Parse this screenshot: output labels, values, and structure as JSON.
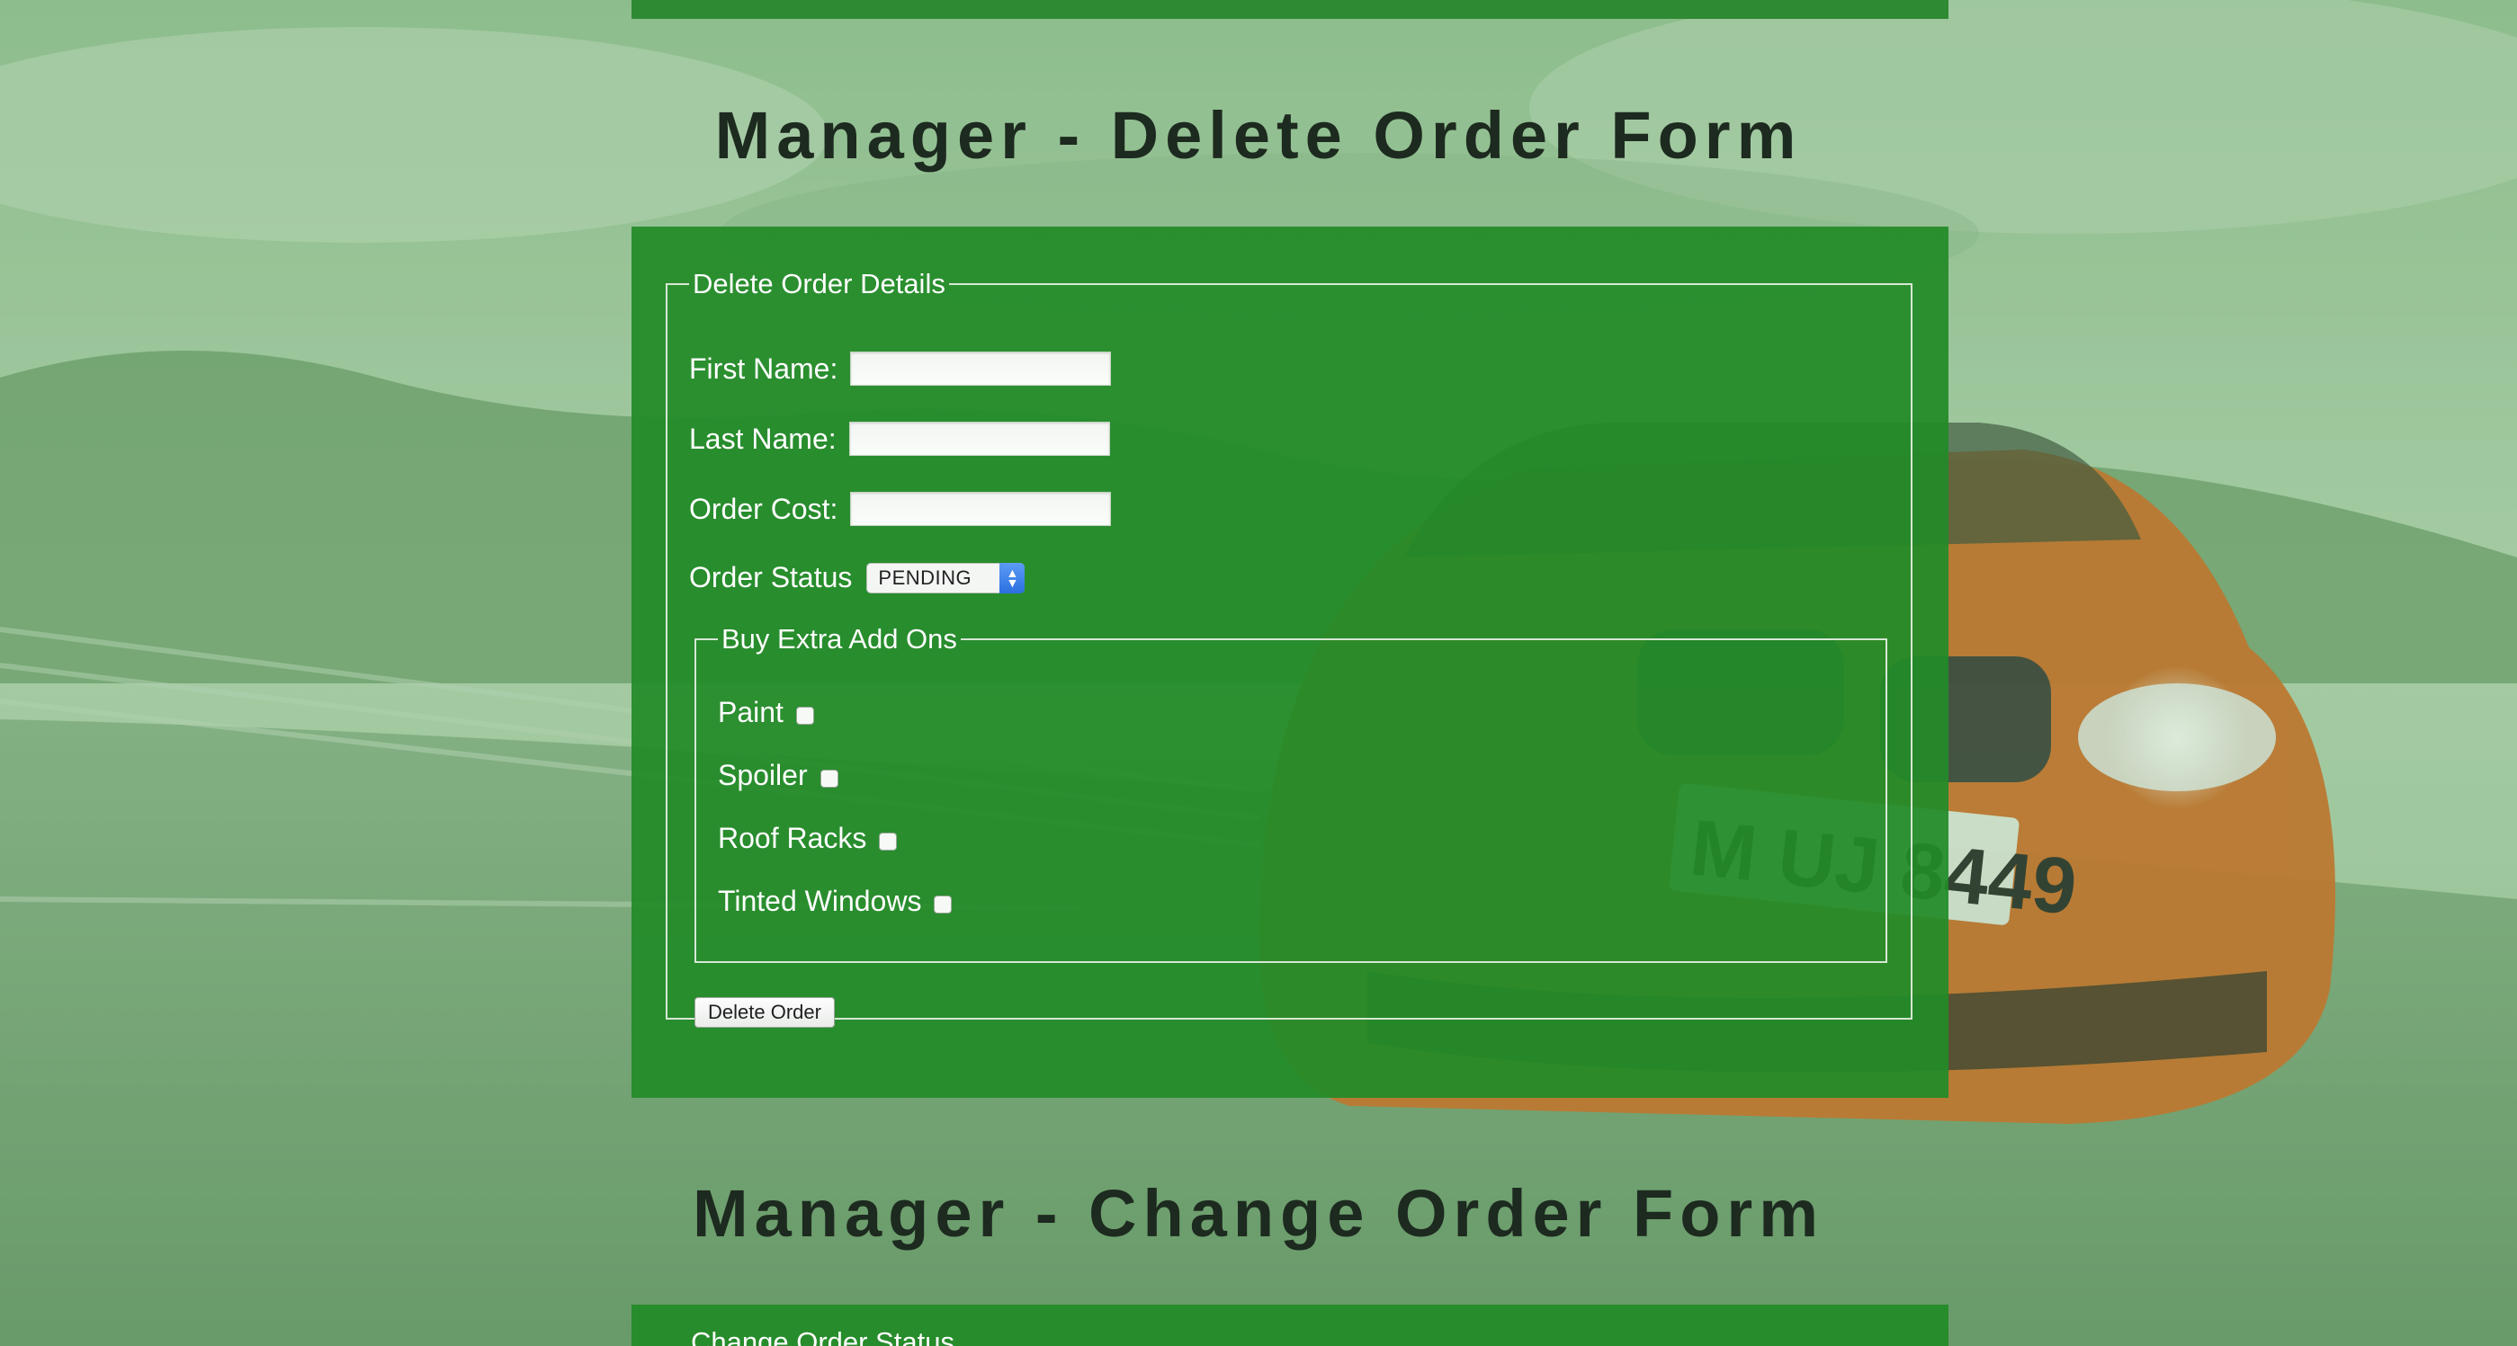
{
  "colors": {
    "panel_green": "#228b28",
    "title_text": "#1d2a1f",
    "background_tint": "#a9c9a8",
    "car_orange": "#d4722c"
  },
  "delete_form": {
    "page_title": "Manager - Delete Order Form",
    "legend": "Delete Order Details",
    "first_name_label": "First Name:",
    "first_name_value": "",
    "last_name_label": "Last Name:",
    "last_name_value": "",
    "order_cost_label": "Order Cost:",
    "order_cost_value": "",
    "order_status_label": "Order Status",
    "order_status_selected": "PENDING",
    "addons": {
      "legend": "Buy Extra Add Ons",
      "items": [
        {
          "label": "Paint",
          "checked": false
        },
        {
          "label": "Spoiler",
          "checked": false
        },
        {
          "label": "Roof Racks",
          "checked": false
        },
        {
          "label": "Tinted Windows",
          "checked": false
        }
      ]
    },
    "submit_label": "Delete Order"
  },
  "change_form": {
    "page_title": "Manager - Change Order Form",
    "legend": "Change Order Status"
  },
  "background": {
    "license_plate": "M UJ 8449"
  }
}
